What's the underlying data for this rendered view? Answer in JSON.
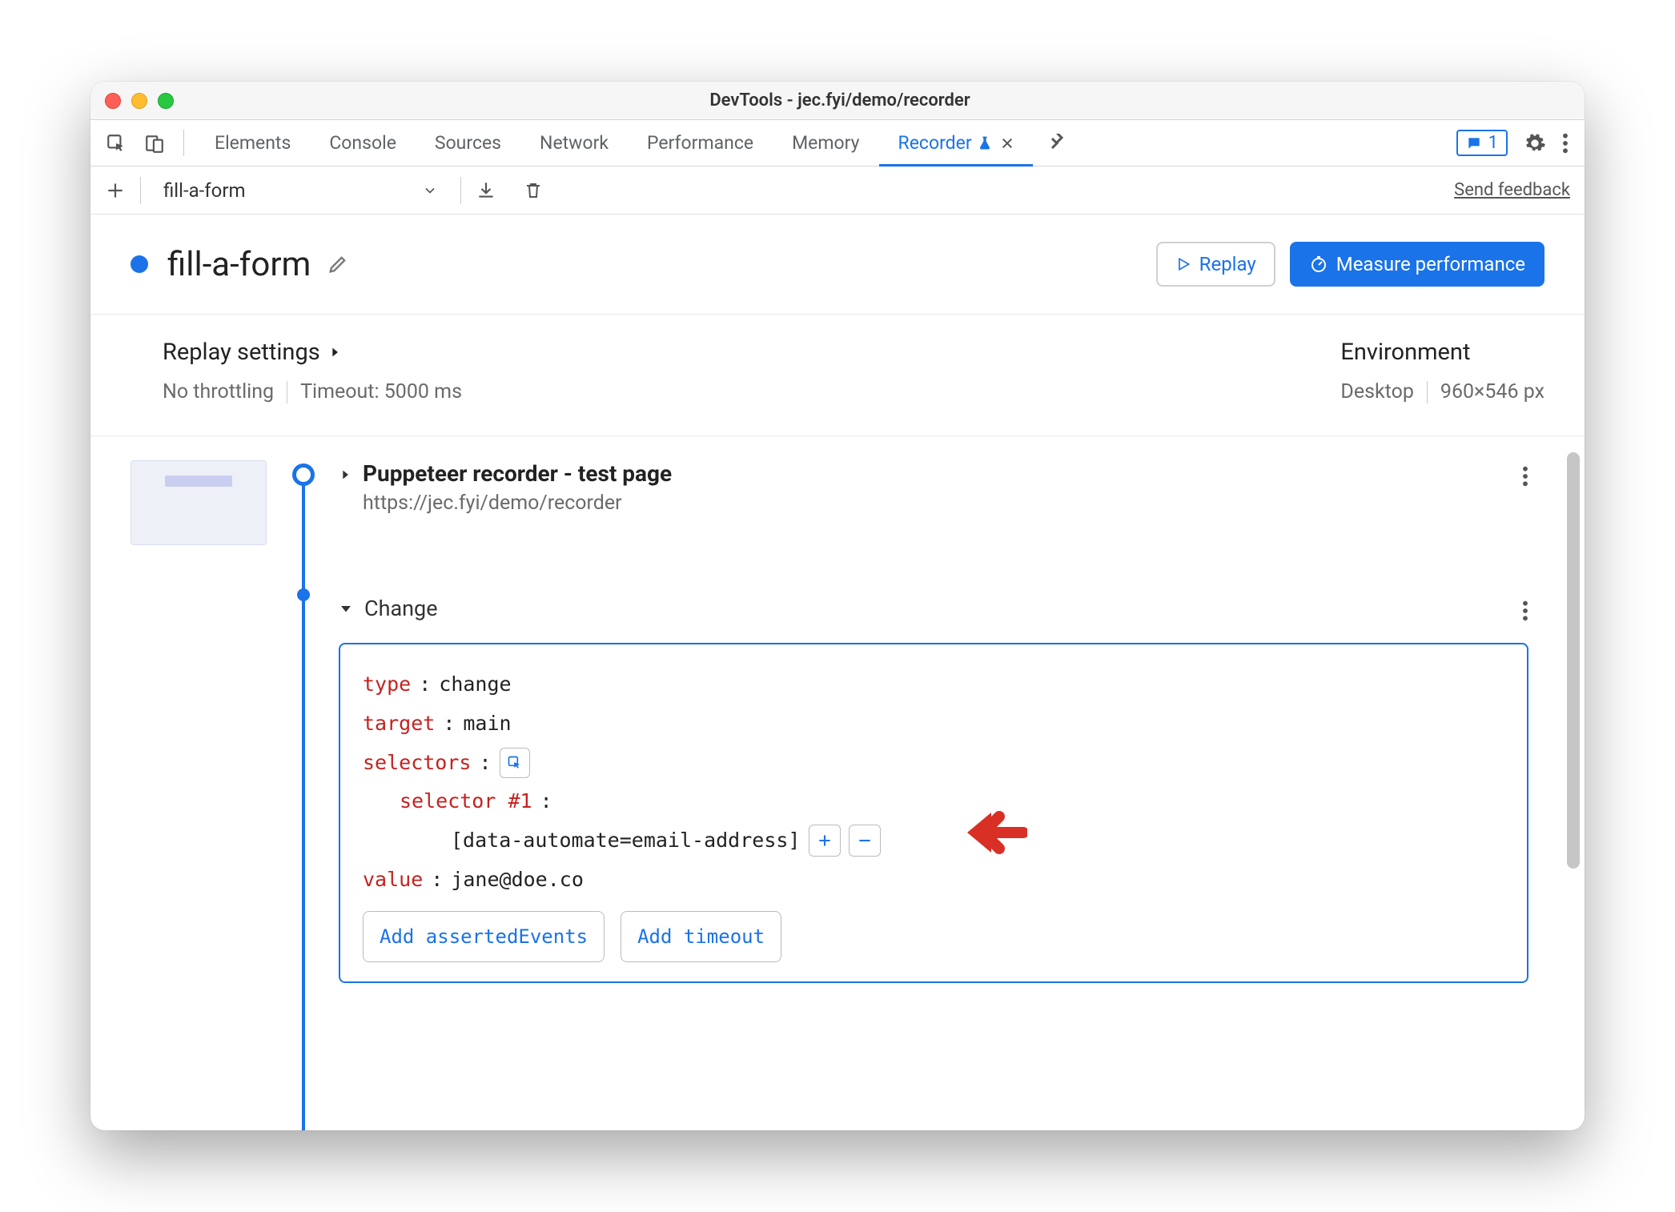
{
  "window_title": "DevTools - jec.fyi/demo/recorder",
  "tabs": {
    "items": [
      "Elements",
      "Console",
      "Sources",
      "Network",
      "Performance",
      "Memory",
      "Recorder"
    ],
    "active": "Recorder",
    "badge_count": "1"
  },
  "toolbar": {
    "recording_name": "fill-a-form",
    "feedback": "Send feedback"
  },
  "header": {
    "title": "fill-a-form",
    "replay": "Replay",
    "measure": "Measure performance"
  },
  "settings": {
    "replay_label": "Replay settings",
    "throttling": "No throttling",
    "timeout": "Timeout: 5000 ms",
    "env_label": "Environment",
    "device": "Desktop",
    "viewport": "960×546 px"
  },
  "steps": {
    "step1": {
      "title": "Puppeteer recorder - test page",
      "url": "https://jec.fyi/demo/recorder"
    },
    "step2": {
      "title": "Change",
      "type_k": "type",
      "type_v": "change",
      "target_k": "target",
      "target_v": "main",
      "selectors_k": "selectors",
      "selector_label": "selector #1",
      "selector_value": "[data-automate=email-address]",
      "value_k": "value",
      "value_v": "jane@doe.co",
      "add_asserted": "Add assertedEvents",
      "add_timeout": "Add timeout"
    }
  }
}
